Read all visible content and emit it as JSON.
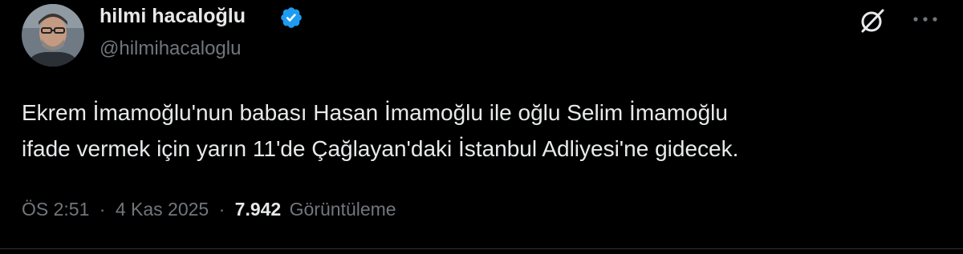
{
  "tweet": {
    "author": {
      "display_name": "hilmi hacaloğlu",
      "handle": "@hilmihacaloglu",
      "verified": true,
      "verified_color": "#1d9bf0"
    },
    "text_lines": [
      "Ekrem İmamoğlu'nun babası Hasan İmamoğlu ile oğlu Selim İmamoğlu",
      "ifade vermek için yarın 11'de Çağlayan'daki İstanbul Adliyesi'ne gidecek."
    ],
    "meta": {
      "time": "ÖS 2:51",
      "separator": "·",
      "date": "4 Kas 2025",
      "views_count": "7.942",
      "views_label": "Görüntüleme"
    },
    "icons": {
      "avatar": "avatar",
      "verified": "verified-badge-icon",
      "grok": "grok-icon",
      "more": "more-options-icon"
    },
    "colors": {
      "background": "#000000",
      "text_primary": "#e7e9ea",
      "text_secondary": "#71767b"
    }
  }
}
